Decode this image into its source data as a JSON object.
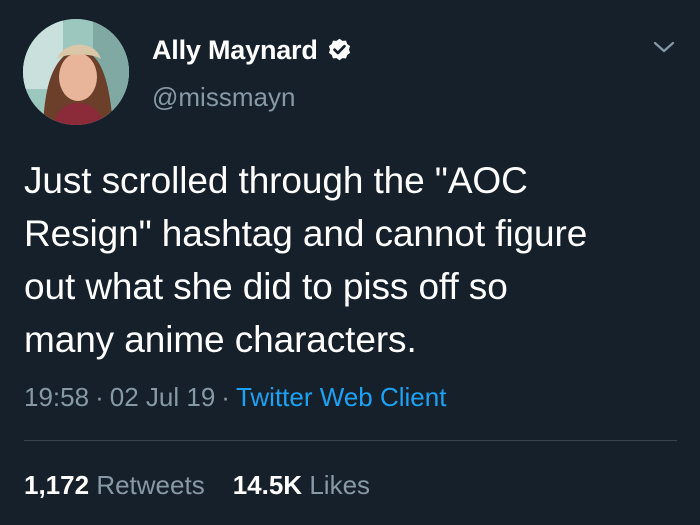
{
  "author": {
    "display_name": "Ally Maynard",
    "handle": "@missmayn",
    "verified": true
  },
  "tweet": {
    "text": "Just scrolled through the \"AOC\nResign\" hashtag and cannot figure\nout what she did to piss off so\nmany anime characters.",
    "time": "19:58",
    "date": "02 Jul 19",
    "separator": "·",
    "client": "Twitter Web Client"
  },
  "stats": {
    "retweets_count": "1,172",
    "retweets_label": "Retweets",
    "likes_count": "14.5K",
    "likes_label": "Likes"
  },
  "icons": {
    "verified": "verified-badge-icon",
    "more": "chevron-down-icon"
  },
  "colors": {
    "background": "#15202b",
    "secondary_text": "#8899a6",
    "link": "#1da1f2",
    "divider": "#38444d"
  }
}
